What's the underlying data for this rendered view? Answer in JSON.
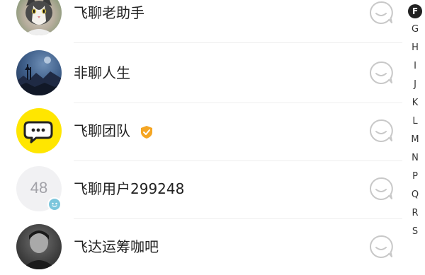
{
  "contacts": [
    {
      "name": "飞聊老助手",
      "avatar": "cat-photo"
    },
    {
      "name": "非聊人生",
      "avatar": "night-landscape-photo"
    },
    {
      "name": "飞聊团队",
      "avatar": "feiliao-logo",
      "verified": true
    },
    {
      "name": "飞聊用户299248",
      "avatar_text": "48",
      "avatar": "default-number-avatar"
    },
    {
      "name": "飞达运筹咖吧",
      "avatar": "person-photo"
    }
  ],
  "row_action_icon": "chat-bubble-icon",
  "index": {
    "active": "F",
    "letters": [
      "F",
      "G",
      "H",
      "I",
      "J",
      "K",
      "L",
      "M",
      "N",
      "P",
      "Q",
      "R",
      "S"
    ]
  },
  "colors": {
    "team_avatar_bg": "#FFE600",
    "verified_badge": "#F5A623",
    "divider": "#EEEEEE",
    "index_active_bg": "#222222"
  }
}
